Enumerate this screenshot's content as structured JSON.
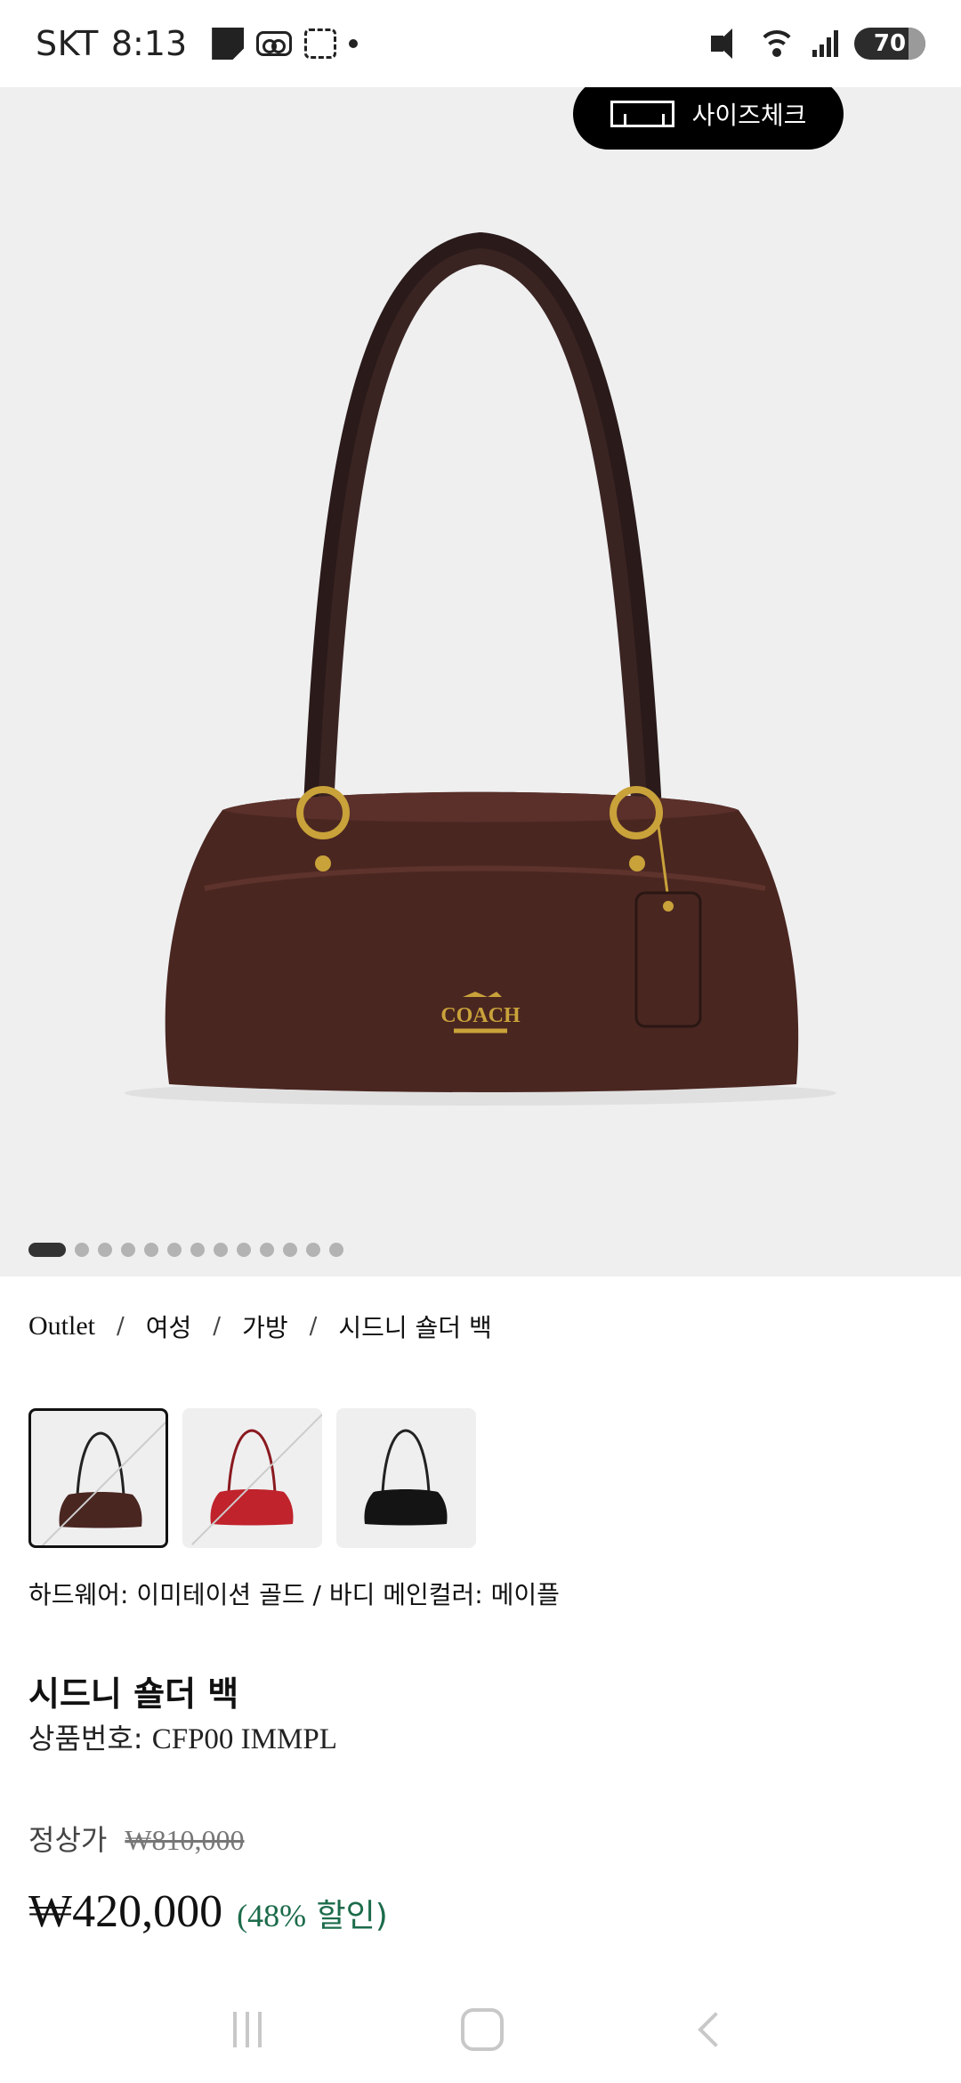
{
  "status_bar": {
    "carrier": "SKT",
    "time": "8:13",
    "wifi_badge": "6",
    "battery": "70"
  },
  "hero": {
    "size_check_label": "사이즈체크",
    "bag_logo": "COACH",
    "image_count": 13,
    "active_index": 0
  },
  "breadcrumb": [
    "Outlet",
    "여성",
    "가방",
    "시드니 숄더 백"
  ],
  "breadcrumb_separator": "/",
  "swatches": [
    {
      "color": "#4a2621",
      "selected": true
    },
    {
      "color": "#c0232c",
      "selected": false
    },
    {
      "color": "#141414",
      "selected": false
    }
  ],
  "product": {
    "hardware_text": "하드웨어: 이미테이션 골드 / 바디 메인컬러: 메이플",
    "title": "시드니 숄더 백",
    "code_label": "상품번호:",
    "code_value": "CFP00 IMMPL",
    "regular_price_label": "정상가",
    "regular_price": "₩810,000",
    "sale_price": "₩420,000",
    "discount_open": "(",
    "discount_pct": "48%",
    "discount_text": "할인)"
  },
  "colors": {
    "accent_green": "#1c6b4b",
    "bag_leather": "#4a2621",
    "hardware_gold": "#c9a23a"
  }
}
